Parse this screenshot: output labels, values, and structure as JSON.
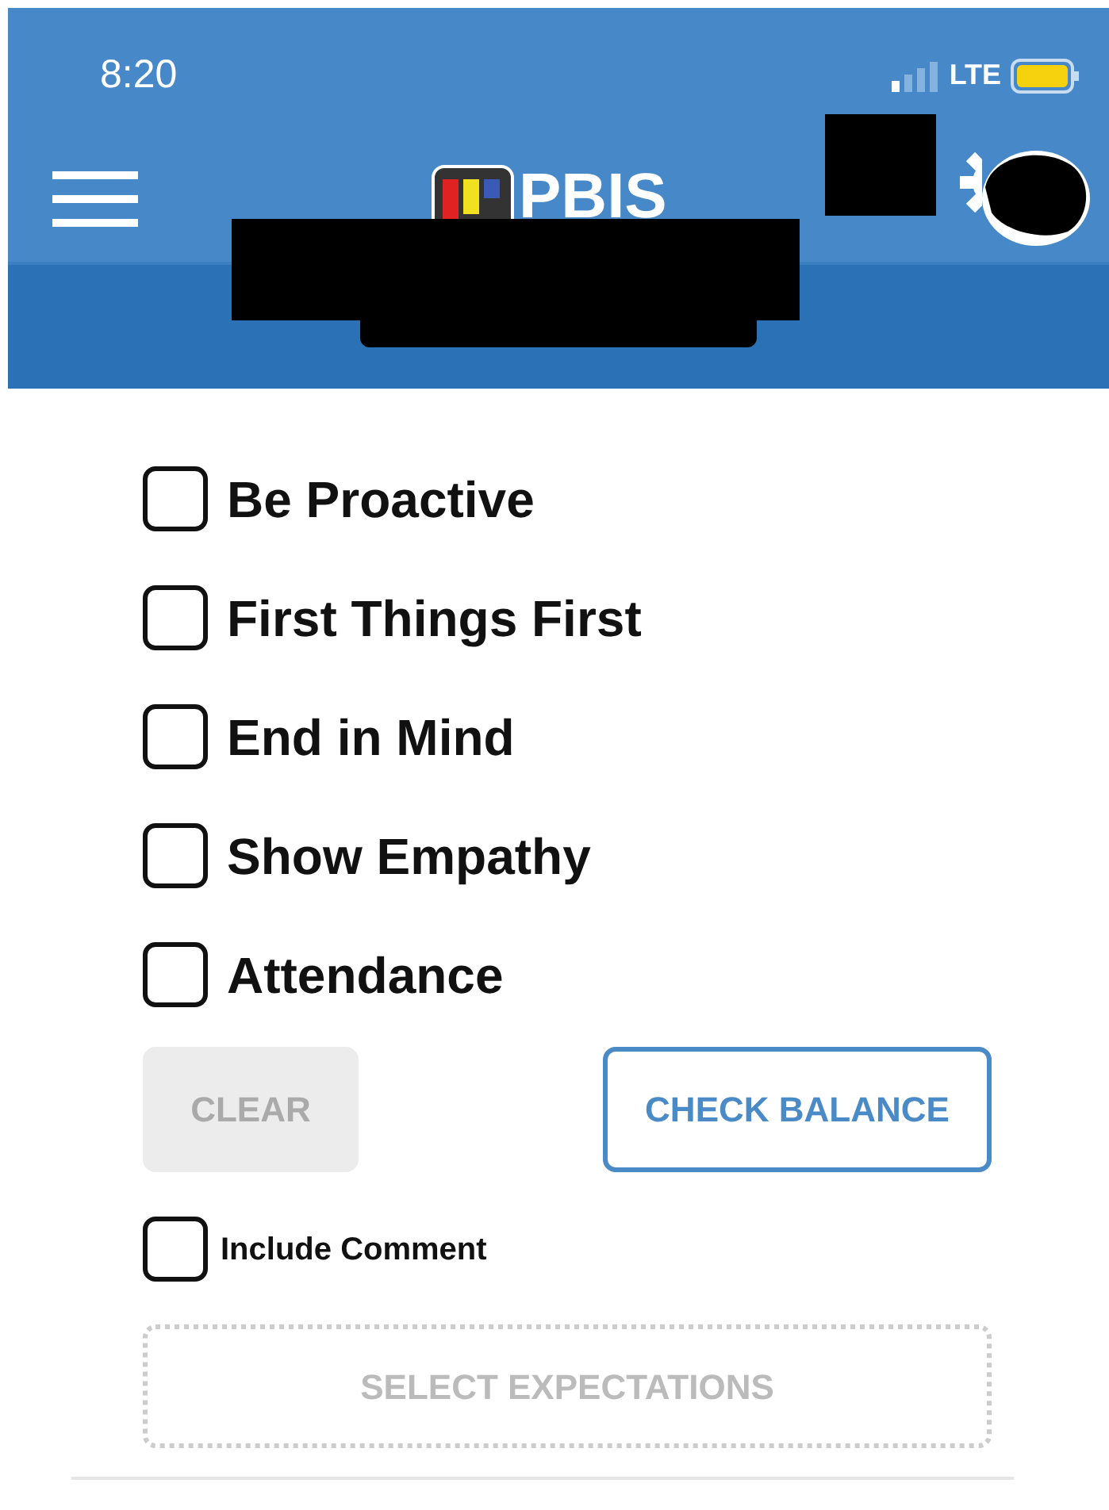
{
  "status_bar": {
    "time": "8:20",
    "network": "LTE"
  },
  "header": {
    "logo_text": "PBIS"
  },
  "expectations": [
    {
      "label": "Be Proactive",
      "checked": false
    },
    {
      "label": "First Things First",
      "checked": false
    },
    {
      "label": "End in Mind",
      "checked": false
    },
    {
      "label": "Show Empathy",
      "checked": false
    },
    {
      "label": "Attendance",
      "checked": false
    }
  ],
  "buttons": [
    {
      "label": "CLEAR",
      "disabled": true
    },
    {
      "label": "CHECK BALANCE",
      "disabled": false
    }
  ],
  "include_comment": {
    "label": "Include Comment",
    "checked": false
  },
  "submit": {
    "label": "SELECT EXPECTATIONS",
    "disabled": true
  }
}
